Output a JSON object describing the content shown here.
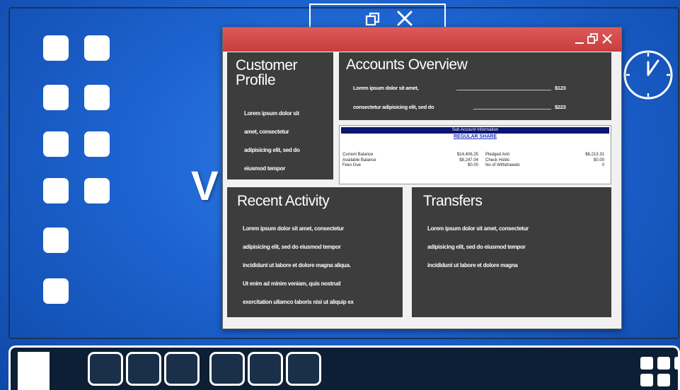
{
  "app_window": {
    "panels": {
      "customer_profile": {
        "title_line1": "Customer",
        "title_line2": "Profile",
        "lines": [
          "Lorem ipsum dolor sit",
          "amet, consectetur",
          "adipisicing elit, sed do",
          "eiusmod tempor"
        ]
      },
      "accounts_overview": {
        "title": "Accounts Overview",
        "rows": [
          {
            "text": "Lorem ipsum dolor sit amet,",
            "amount": "$123"
          },
          {
            "text": "consectetur adipisicing elit, sed do",
            "amount": "$223"
          }
        ]
      },
      "sub_account": {
        "header": "Sub Account Information",
        "link": "REGULAR SHARE",
        "left_labels": [
          "Current Balance",
          "Available Balance",
          "Fees Due"
        ],
        "left_values": [
          "$14,406.25",
          "$8,247.04",
          "$0.00"
        ],
        "right_labels": [
          "Pledged Amt",
          "Check Holds",
          "No of Withdrawals"
        ],
        "right_values": [
          "$6,213.31",
          "$0.00",
          "0"
        ]
      },
      "recent_activity": {
        "title": "Recent Activity",
        "lines": [
          "Lorem ipsum dolor sit amet, consectetur",
          "adipisicing elit, sed do eiusmod tempor",
          "incididunt ut labore et dolore magna aliqua.",
          "Ut enim ad minim veniam, quis nostrud",
          "exercitation ullamco laboris nisi ut aliquip ex"
        ]
      },
      "transfers": {
        "title": "Transfers",
        "lines": [
          "Lorem ipsum dolor sit amet, consectetur",
          "adipisicing elit, sed do eiusmod tempor",
          "incididunt ut labore et dolore magna"
        ]
      }
    }
  },
  "desktop": {
    "partial_letter": "V"
  },
  "icons": {
    "titlebar": [
      "minimize-icon",
      "restore-icon",
      "close-icon"
    ],
    "desktop": [
      "app-tile-icon",
      "clock-icon",
      "grid-menu-icon"
    ]
  },
  "colors": {
    "desktop_blue": "#1d63d0",
    "titlebar_red": "#d24848",
    "panel_dark": "#3d3d3d",
    "sub_header_navy": "#0b1570",
    "link_blue": "#1c2ec2"
  }
}
